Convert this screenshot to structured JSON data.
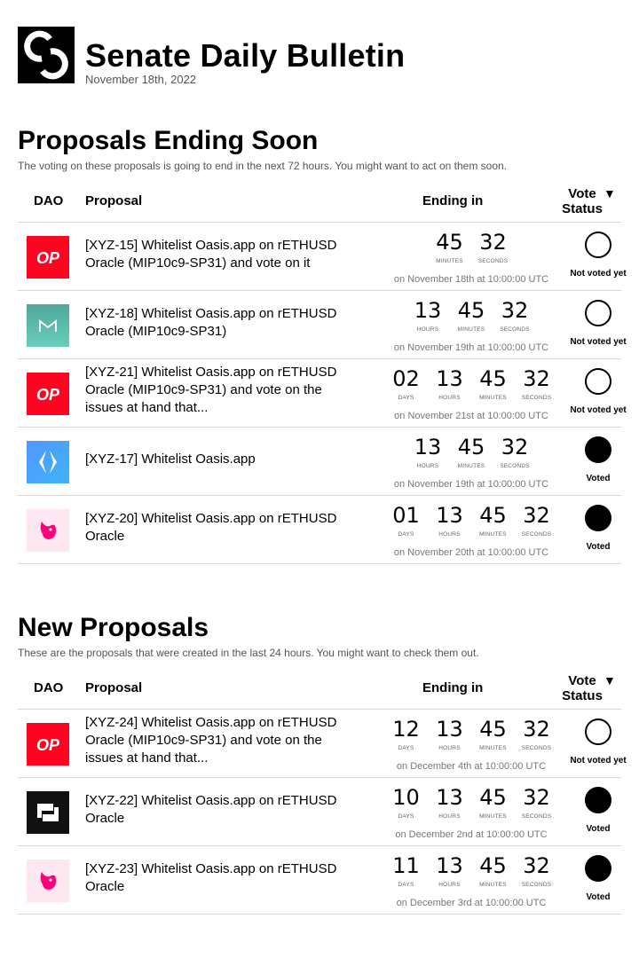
{
  "header": {
    "title": "Senate Daily Bulletin",
    "date": "November 18th, 2022"
  },
  "columns": {
    "dao": "DAO",
    "proposal": "Proposal",
    "ending": "Ending in",
    "vote": "Vote Status",
    "sort_icon": "triangle-down-icon"
  },
  "ending_soon": {
    "title": "Proposals Ending Soon",
    "description": "The voting on these proposals is going to end in the next 72 hours. You might want to act on them soon.",
    "rows": [
      {
        "dao": "op-logo-icon",
        "text": "[XYZ-15] Whitelist Oasis.app on rETHUSD Oracle (MIP10c9-SP31) and vote on it",
        "units": [
          {
            "value": "45",
            "label": "MINUTES"
          },
          {
            "value": "32",
            "label": "SECONDS"
          }
        ],
        "ending": "on November 18th at 10:00:00 UTC",
        "status": "Not voted yet",
        "voted": false
      },
      {
        "dao": "maker-logo-icon",
        "text": "[XYZ-18] Whitelist Oasis.app on rETHUSD Oracle (MIP10c9-SP31)",
        "units": [
          {
            "value": "13",
            "label": "HOURS"
          },
          {
            "value": "45",
            "label": "MINUTES"
          },
          {
            "value": "32",
            "label": "SECONDS"
          }
        ],
        "ending": "on November 19th at 10:00:00 UTC",
        "status": "Not voted yet",
        "voted": false
      },
      {
        "dao": "op-logo-icon",
        "text": "[XYZ-21] Whitelist Oasis.app on rETHUSD Oracle (MIP10c9-SP31) and vote on the issues at hand that...",
        "units": [
          {
            "value": "02",
            "label": "DAYS"
          },
          {
            "value": "13",
            "label": "HOURS"
          },
          {
            "value": "45",
            "label": "MINUTES"
          },
          {
            "value": "32",
            "label": "SECONDS"
          }
        ],
        "ending": "on November 21st at 10:00:00 UTC",
        "status": "Not voted yet",
        "voted": false
      },
      {
        "dao": "ens-logo-icon",
        "text": "[XYZ-17] Whitelist Oasis.app",
        "units": [
          {
            "value": "13",
            "label": "HOURS"
          },
          {
            "value": "45",
            "label": "MINUTES"
          },
          {
            "value": "32",
            "label": "SECONDS"
          }
        ],
        "ending": "on November 19th at 10:00:00 UTC",
        "status": "Voted",
        "voted": true
      },
      {
        "dao": "uniswap-logo-icon",
        "text": "[XYZ-20] Whitelist Oasis.app on rETHUSD Oracle",
        "units": [
          {
            "value": "01",
            "label": "DAYS"
          },
          {
            "value": "13",
            "label": "HOURS"
          },
          {
            "value": "45",
            "label": "MINUTES"
          },
          {
            "value": "32",
            "label": "SECONDS"
          }
        ],
        "ending": "on November 20th at 10:00:00 UTC",
        "status": "Voted",
        "voted": true
      }
    ]
  },
  "new_proposals": {
    "title": "New Proposals",
    "description": "These are the proposals that were created in the last 24 hours. You might want to check them out.",
    "rows": [
      {
        "dao": "op-logo-icon",
        "text": "[XYZ-24] Whitelist Oasis.app on rETHUSD Oracle (MIP10c9-SP31) and vote on the issues at hand that...",
        "units": [
          {
            "value": "12",
            "label": "DAYS"
          },
          {
            "value": "13",
            "label": "HOURS"
          },
          {
            "value": "45",
            "label": "MINUTES"
          },
          {
            "value": "32",
            "label": "SECONDS"
          }
        ],
        "ending": "on December 4th at 10:00:00 UTC",
        "status": "Not voted yet",
        "voted": false
      },
      {
        "dao": "dao-square-logo-icon",
        "text": "[XYZ-22] Whitelist Oasis.app on rETHUSD Oracle",
        "units": [
          {
            "value": "10",
            "label": "DAYS"
          },
          {
            "value": "13",
            "label": "HOURS"
          },
          {
            "value": "45",
            "label": "MINUTES"
          },
          {
            "value": "32",
            "label": "SECONDS"
          }
        ],
        "ending": "on December 2nd at 10:00:00 UTC",
        "status": "Voted",
        "voted": true
      },
      {
        "dao": "uniswap-logo-icon",
        "text": "[XYZ-23] Whitelist Oasis.app on rETHUSD Oracle",
        "units": [
          {
            "value": "11",
            "label": "DAYS"
          },
          {
            "value": "13",
            "label": "HOURS"
          },
          {
            "value": "45",
            "label": "MINUTES"
          },
          {
            "value": "32",
            "label": "SECONDS"
          }
        ],
        "ending": "on December 3rd at 10:00:00 UTC",
        "status": "Voted",
        "voted": true
      }
    ]
  }
}
